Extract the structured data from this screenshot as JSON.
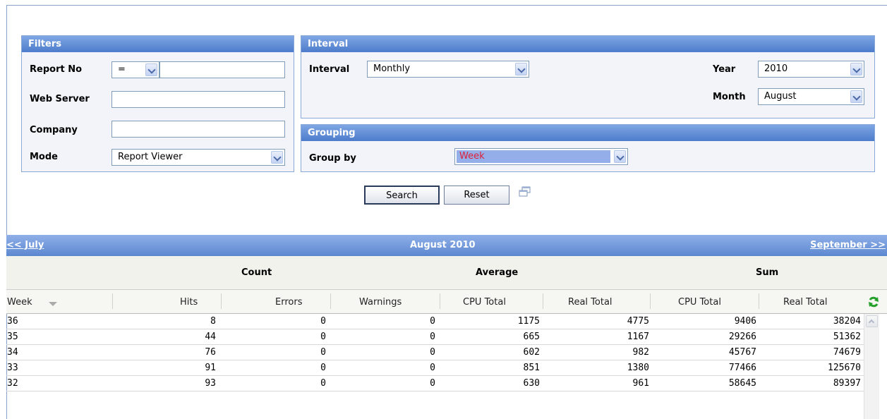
{
  "filters": {
    "title": "Filters",
    "report_no_label": "Report No",
    "report_no_operator": "=",
    "report_no_value": "",
    "web_server_label": "Web Server",
    "web_server_value": "",
    "company_label": "Company",
    "company_value": "",
    "mode_label": "Mode",
    "mode_value": "Report Viewer"
  },
  "interval": {
    "title": "Interval",
    "interval_label": "Interval",
    "interval_value": "Monthly",
    "year_label": "Year",
    "year_value": "2010",
    "month_label": "Month",
    "month_value": "August"
  },
  "grouping": {
    "title": "Grouping",
    "group_by_label": "Group by",
    "group_by_value": "Week"
  },
  "actions": {
    "search_label": "Search",
    "reset_label": "Reset"
  },
  "nav": {
    "prev_label": "<< July",
    "current_label": "August 2010",
    "next_label": "September >>"
  },
  "groups": {
    "count": "Count",
    "average": "Average",
    "sum": "Sum"
  },
  "columns": [
    "Week",
    "Hits",
    "Errors",
    "Warnings",
    "CPU Total",
    "Real Total",
    "CPU Total",
    "Real Total"
  ],
  "rows": [
    [
      "36",
      "8",
      "0",
      "0",
      "1175",
      "4775",
      "9406",
      "38204"
    ],
    [
      "35",
      "44",
      "0",
      "0",
      "665",
      "1167",
      "29266",
      "51362"
    ],
    [
      "34",
      "76",
      "0",
      "0",
      "602",
      "982",
      "45767",
      "74679"
    ],
    [
      "33",
      "91",
      "0",
      "0",
      "851",
      "1380",
      "77466",
      "125670"
    ],
    [
      "32",
      "93",
      "0",
      "0",
      "630",
      "961",
      "58645",
      "89397"
    ]
  ],
  "colors": {
    "panel_header": "#4d7ccb",
    "group_by_highlight": "#93aee8",
    "group_by_text": "#e0203a"
  }
}
